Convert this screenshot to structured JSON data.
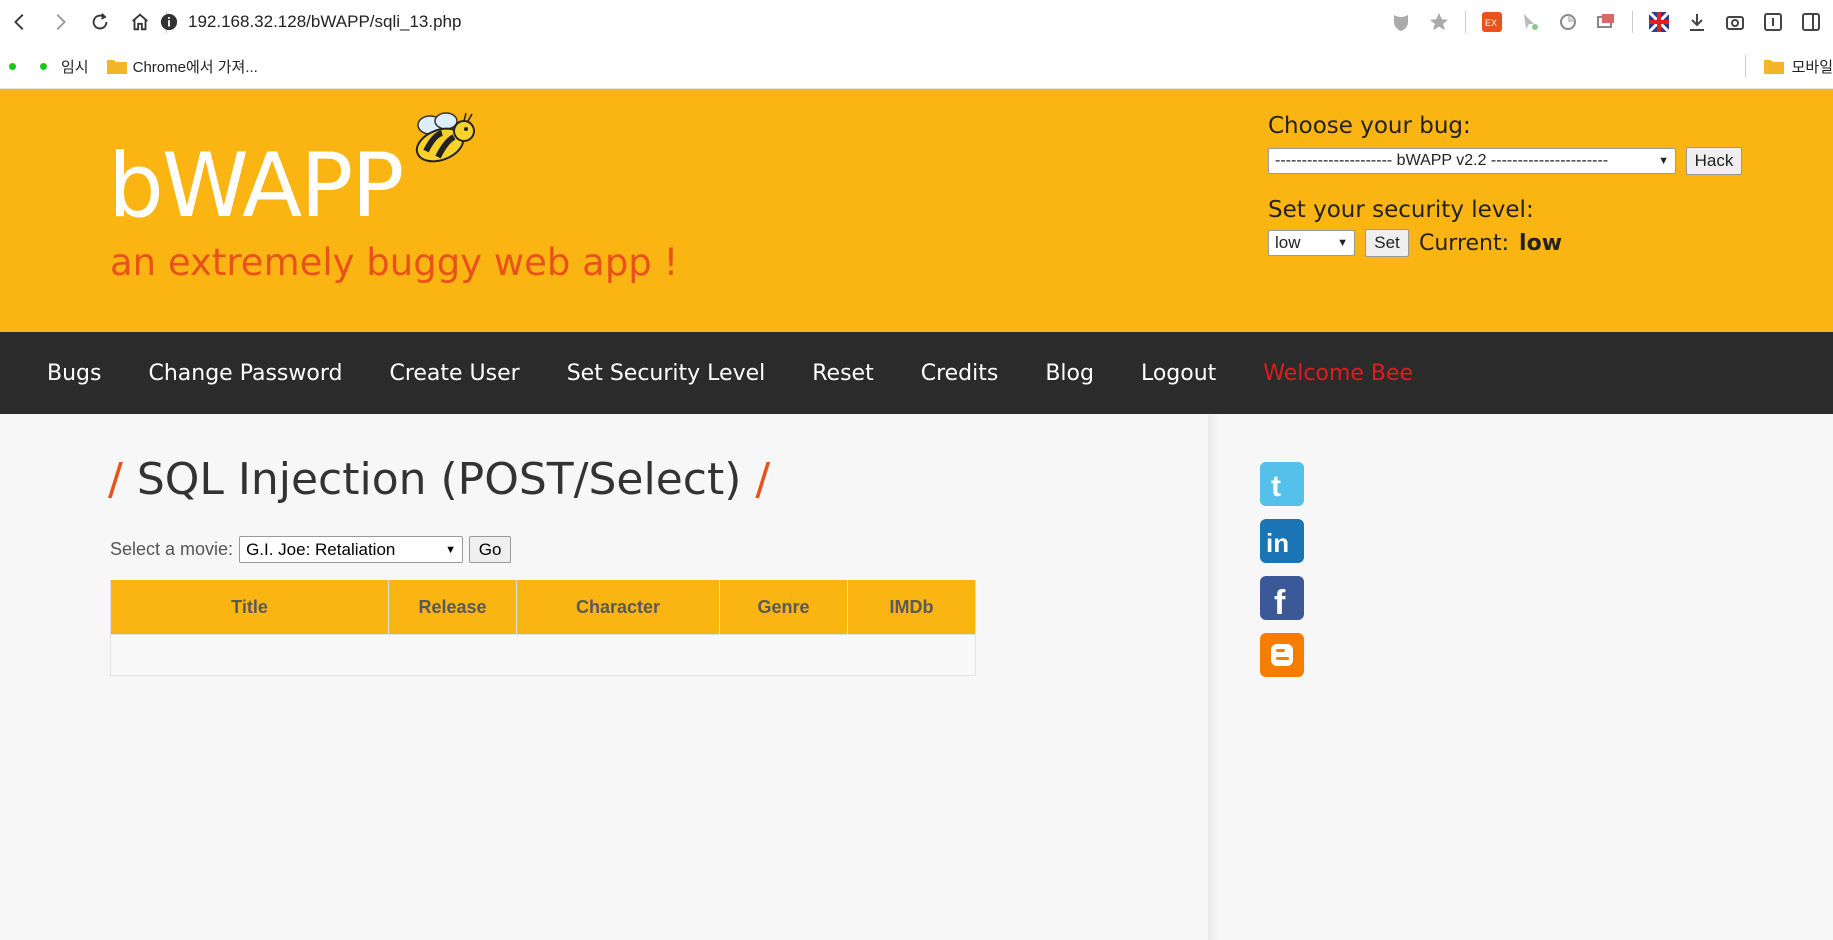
{
  "browser": {
    "url": "192.168.32.128/bWAPP/sqli_13.php",
    "bookmarks": [
      {
        "label": "임시"
      },
      {
        "label": "Chrome에서 가져..."
      }
    ],
    "mobile_bookmarks": "모바일"
  },
  "header": {
    "logo": "bWAPP",
    "tagline": "an extremely buggy web app !",
    "choose_bug_label": "Choose your bug:",
    "bug_select_value": "---------------------- bWAPP v2.2 ----------------------",
    "hack_button": "Hack",
    "security_label": "Set your security level:",
    "security_select_value": "low",
    "set_button": "Set",
    "current_label": "Current:",
    "current_value": "low"
  },
  "menu": {
    "items": [
      "Bugs",
      "Change Password",
      "Create User",
      "Set Security Level",
      "Reset",
      "Credits",
      "Blog",
      "Logout"
    ],
    "welcome": "Welcome Bee"
  },
  "main": {
    "title_slash": "/",
    "title": "SQL Injection (POST/Select)",
    "movie_label": "Select a movie:",
    "movie_select_value": "G.I. Joe: Retaliation",
    "go_button": "Go",
    "table_headers": [
      "Title",
      "Release",
      "Character",
      "Genre",
      "IMDb"
    ]
  },
  "social": [
    "twitter-icon",
    "linkedin-icon",
    "facebook-icon",
    "blogger-icon"
  ],
  "colors": {
    "header_bg": "#fbb512",
    "menu_bg": "#2b2b2b",
    "accent": "#e9521b",
    "welcome": "#e01c1c"
  }
}
